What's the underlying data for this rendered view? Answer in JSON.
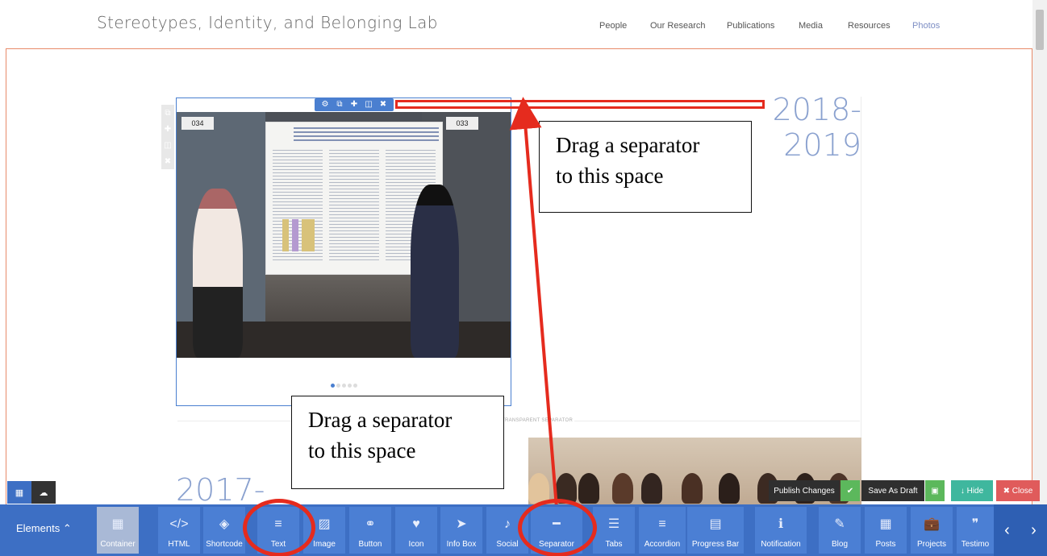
{
  "site": {
    "title": "Stereotypes, Identity, and Belonging Lab",
    "nav": [
      "People",
      "Our Research",
      "Publications",
      "Media",
      "Resources",
      "Photos"
    ],
    "active_nav": "Photos"
  },
  "content": {
    "year_1_line1": "2018-",
    "year_1_line2": "2019",
    "year_2": "2017-",
    "separator_label": "TRANSPARENT SEPARATOR",
    "booth_left": "034",
    "booth_right": "033"
  },
  "callouts": {
    "c1_line1": "Drag a separator",
    "c1_line2": "to this space",
    "c2_line1": "Drag a separator",
    "c2_line2": "to this space"
  },
  "actions": {
    "publish": "Publish Changes",
    "save_draft": "Save As Draft",
    "hide": "Hide",
    "close": "Close"
  },
  "elements_bar": {
    "label": "Elements",
    "items": [
      "Container",
      "HTML",
      "Shortcode",
      "Text",
      "Image",
      "Button",
      "Icon",
      "Info Box",
      "Social",
      "Separator",
      "Tabs",
      "Accordion",
      "Progress Bar",
      "Notification",
      "Blog",
      "Posts",
      "Projects",
      "Testimo"
    ]
  },
  "colors": {
    "accent": "#3d6fc4",
    "annotation_red": "#e52b1e",
    "year_text": "#8aa1cf",
    "publish_green": "#5cb85c",
    "hide_teal": "#3fb79e",
    "close_red": "#e05b5b"
  }
}
